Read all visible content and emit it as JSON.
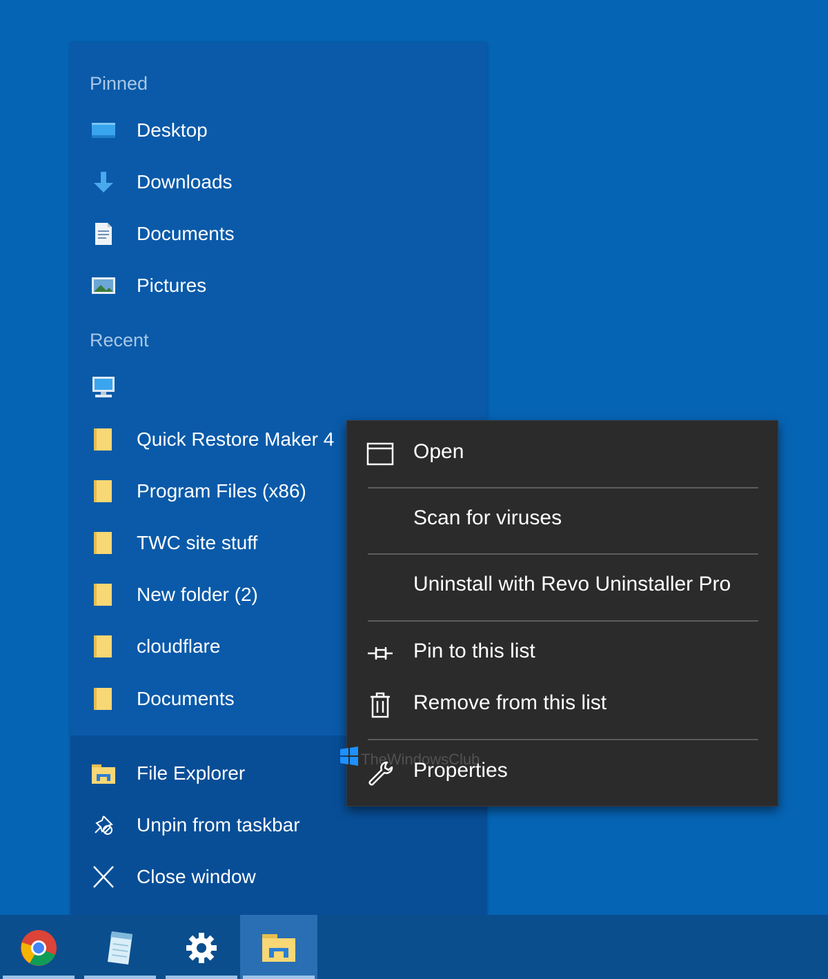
{
  "jumplist": {
    "pinned_header": "Pinned",
    "pinned": [
      {
        "label": "Desktop",
        "icon": "desktop-icon"
      },
      {
        "label": "Downloads",
        "icon": "download-arrow-icon"
      },
      {
        "label": "Documents",
        "icon": "document-icon"
      },
      {
        "label": "Pictures",
        "icon": "pictures-icon"
      }
    ],
    "recent_header": "Recent",
    "recent": [
      {
        "label": "",
        "icon": "computer-icon"
      },
      {
        "label": "Quick Restore Maker 4",
        "icon": "folder-icon"
      },
      {
        "label": "Program Files (x86)",
        "icon": "folder-icon"
      },
      {
        "label": "TWC site stuff",
        "icon": "folder-icon"
      },
      {
        "label": "New folder (2)",
        "icon": "folder-icon"
      },
      {
        "label": "cloudflare",
        "icon": "folder-icon"
      },
      {
        "label": "Documents",
        "icon": "folder-icon"
      }
    ],
    "tasks": [
      {
        "label": "File Explorer",
        "icon": "file-explorer-icon"
      },
      {
        "label": "Unpin from taskbar",
        "icon": "unpin-icon"
      },
      {
        "label": "Close window",
        "icon": "close-icon"
      }
    ]
  },
  "context_menu": {
    "items": [
      {
        "label": "Open",
        "icon": "window-icon"
      },
      {
        "label": "Scan for viruses",
        "icon": ""
      },
      {
        "label": "Uninstall with Revo Uninstaller Pro",
        "icon": ""
      },
      {
        "label": "Pin to this list",
        "icon": "pin-icon"
      },
      {
        "label": "Remove from this list",
        "icon": "trash-icon"
      },
      {
        "label": "Properties",
        "icon": "wrench-icon"
      }
    ],
    "watermark": "TheWindowsClub"
  },
  "taskbar": {
    "apps": [
      {
        "name": "Chrome",
        "icon": "chrome-icon",
        "active": false
      },
      {
        "name": "Notepad",
        "icon": "notepad-icon",
        "active": false
      },
      {
        "name": "Settings",
        "icon": "settings-gear-icon",
        "active": false
      },
      {
        "name": "File Explorer",
        "icon": "file-explorer-icon",
        "active": true
      }
    ]
  },
  "colors": {
    "desktop_bg": "#0664b5",
    "jumplist_bg": "#0a5aa9",
    "jumplist_tasks_bg": "#084e97",
    "menu_bg": "#2b2b2b",
    "header_text": "#a9c7e6",
    "folder_yellow": "#f8d775"
  }
}
